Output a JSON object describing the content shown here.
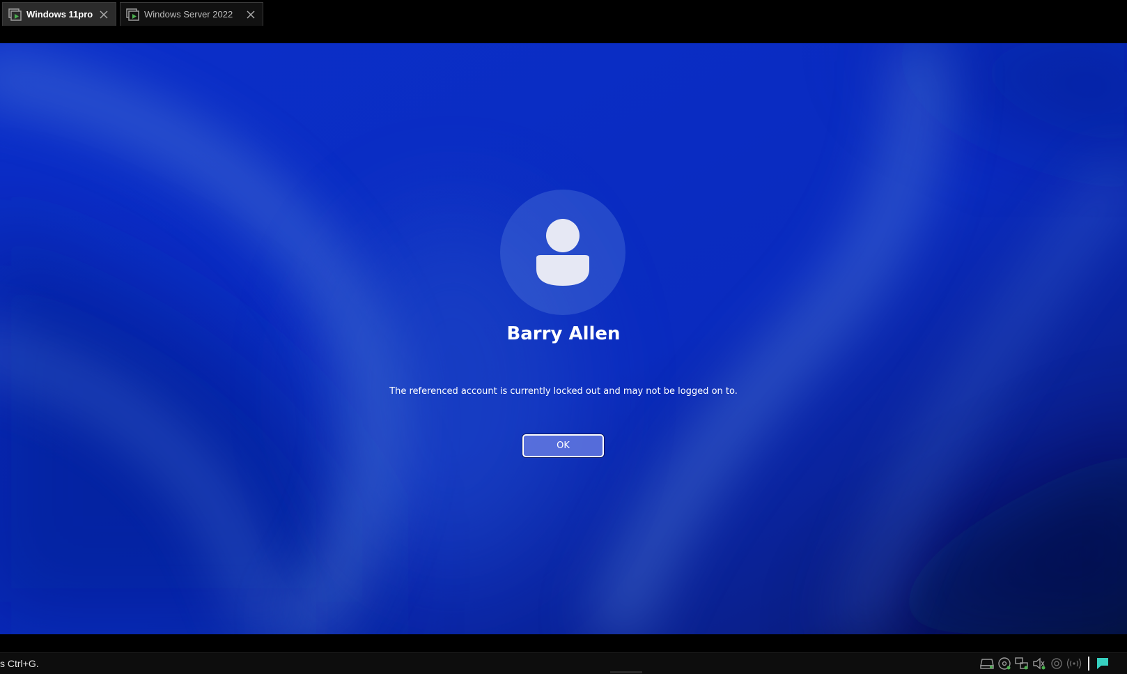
{
  "tabs": [
    {
      "label": "Windows 11pro",
      "active": true
    },
    {
      "label": "Windows Server 2022",
      "active": false
    }
  ],
  "lock_screen": {
    "user_name": "Barry Allen",
    "message": "The referenced account is currently locked out and may not be logged on to.",
    "ok_label": "OK",
    "avatar_icon": "user-avatar-icon"
  },
  "status_bar": {
    "hint_text": "s Ctrl+G.",
    "tray_icons": [
      "hard-disk-icon",
      "cd-dvd-icon",
      "network-icon",
      "sound-icon",
      "usb-icon",
      "wireless-icon",
      "message-icon"
    ]
  },
  "colors": {
    "desktop_blue": "#0c2dc4",
    "vm_icon_green": "#4caf50",
    "tray_accent": "#36d0c0"
  }
}
